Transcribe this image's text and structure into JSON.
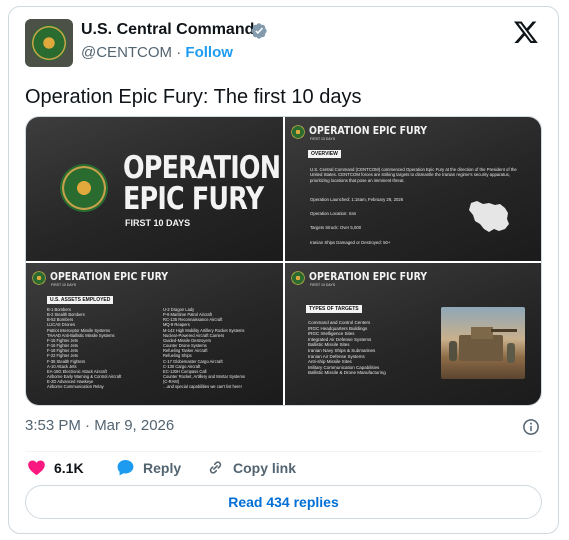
{
  "author": {
    "name": "U.S. Central Command",
    "handle": "@CENTCOM",
    "separator": "·",
    "follow_label": "Follow"
  },
  "tweet": {
    "text": "Operation Epic Fury: The first 10 days",
    "timestamp": "3:53 PM · Mar 9, 2026"
  },
  "media": {
    "panel1": {
      "title_line1": "OPERATION",
      "title_line2": "EPIC FURY",
      "subtitle": "FIRST 10 DAYS"
    },
    "panel2": {
      "title": "OPERATION EPIC FURY",
      "subtitle": "FIRST 10 DAYS",
      "tag": "OVERVIEW",
      "overview_text": "U.S. Central Command (CENTCOM) commenced Operation Epic Fury at the direction of the President of the United States. CENTCOM forces are striking targets to dismantle the Iranian regime's security apparatus, prioritizing locations that pose an imminent threat.",
      "launched": "Operation Launched: 1:15am, February 28, 2026",
      "location": "Operation Location: Iran",
      "targets_struck": "Targets Struck: Over 5,000",
      "ships": "Iranian Ships Damaged or Destroyed: 50+"
    },
    "panel3": {
      "title": "OPERATION EPIC FURY",
      "subtitle": "FIRST 10 DAYS",
      "tag": "U.S. ASSETS EMPLOYED",
      "left_column": [
        "B-1 Bombers",
        "B-2 Stealth Bombers",
        "B-52 Bombers",
        "LUCAS Drones",
        "Patriot Interceptor Missile Systems",
        "THAAD Anti-Ballistic Missile Systems",
        "F-15 Fighter Jets",
        "F-16 Fighter Jets",
        "F-18 Fighter Jets",
        "F-22 Fighter Jets",
        "F-35 Stealth Fighters",
        "A-10 Attack Jets",
        "EA-18G Electronic Attack Aircraft",
        "Airborne Early Warning & Control Aircraft",
        "E-2D Advanced Hawkeye",
        "Airborne Communication Relay"
      ],
      "right_column": [
        "U-2 Dragon Lady",
        "P-8 Maritime Patrol Aircraft",
        "RC-135 Reconnaissance Aircraft",
        "MQ-9 Reapers",
        "M-142 High Mobility Artillery Rocket Systems",
        "Nuclear-Powered Aircraft Carriers",
        "Guided-Missile Destroyers",
        "Counter Drone Systems",
        "Refueling Tanker Aircraft",
        "Refueling Ships",
        "C-17 Globemaster Cargo Aircraft",
        "C-130 Cargo Aircraft",
        "EC-130H Compass Call",
        "Counter Rocket, Artillery and Mortar Systems",
        "(C-RAM)",
        "…and special capabilities we can't list here!"
      ]
    },
    "panel4": {
      "title": "OPERATION EPIC FURY",
      "subtitle": "FIRST 10 DAYS",
      "tag": "TYPES OF TARGETS",
      "targets": [
        "Command and Control Centers",
        "IRGC Headquarters Buildings",
        "IRGC Intelligence Sites",
        "Integrated Air Defense Systems",
        "Ballistic Missile Sites",
        "Iranian Navy Ships & Submarines",
        "Iranian Air Defense Systems",
        "Anti-ship Missile Sites",
        "Military Communication Capabilities",
        "Ballistic Missile & Drone Manufacturing"
      ]
    }
  },
  "actions": {
    "like_count": "6.1K",
    "reply_label": "Reply",
    "copy_link_label": "Copy link"
  },
  "read_replies_label": "Read 434 replies",
  "icons": {
    "verified": "verified-badge-icon",
    "platform": "x-logo-icon",
    "info": "info-icon",
    "like": "heart-icon",
    "reply": "speech-bubble-icon",
    "copy_link": "link-icon"
  },
  "colors": {
    "accent_blue": "#1d9bf0",
    "like_pink": "#f91880",
    "muted_text": "#536471",
    "border": "#cfd9de"
  }
}
